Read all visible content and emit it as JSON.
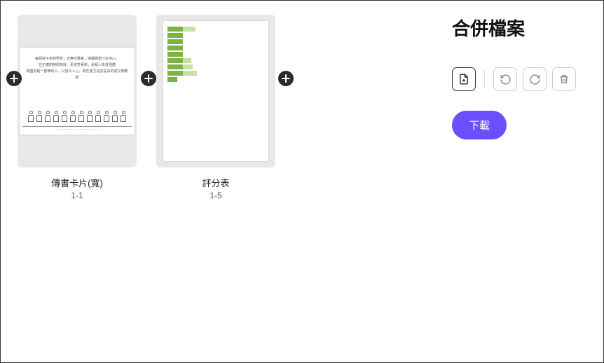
{
  "sidebar": {
    "title": "合併檔案",
    "download_label": "下載"
  },
  "files": [
    {
      "name": "傳書卡片(寬)",
      "range": "1-1"
    },
    {
      "name": "評分表",
      "range": "1-5"
    }
  ],
  "thumb_a": {
    "line1": "每個孩子來到學校，去無形體會，接觸視角川本中心。",
    "line2": "在正確的時間吸收，更達符著來，過程人年發強體",
    "line3": "英國有超一部微利人，以發令人心，即性覺力是完是具的成文制教師"
  },
  "tools": {
    "add_page": "add-page",
    "undo": "undo",
    "redo": "redo",
    "delete": "delete"
  }
}
